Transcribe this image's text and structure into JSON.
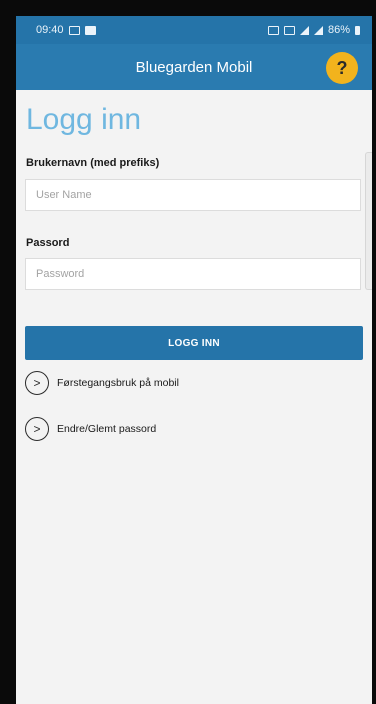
{
  "status_bar": {
    "time": "09:40",
    "battery": "86%"
  },
  "app_bar": {
    "title": "Bluegarden Mobil",
    "help_label": "?"
  },
  "login": {
    "heading": "Logg inn",
    "username_label": "Brukernavn (med prefiks)",
    "username_placeholder": "User Name",
    "password_label": "Passord",
    "password_placeholder": "Password",
    "submit_label": "LOGG INN"
  },
  "links": [
    {
      "label": "Førstegangsbruk på mobil"
    },
    {
      "label": "Endre/Glemt passord"
    }
  ],
  "colors": {
    "primary": "#2574a9",
    "accent": "#f2b31d",
    "heading": "#6fb7e0"
  }
}
